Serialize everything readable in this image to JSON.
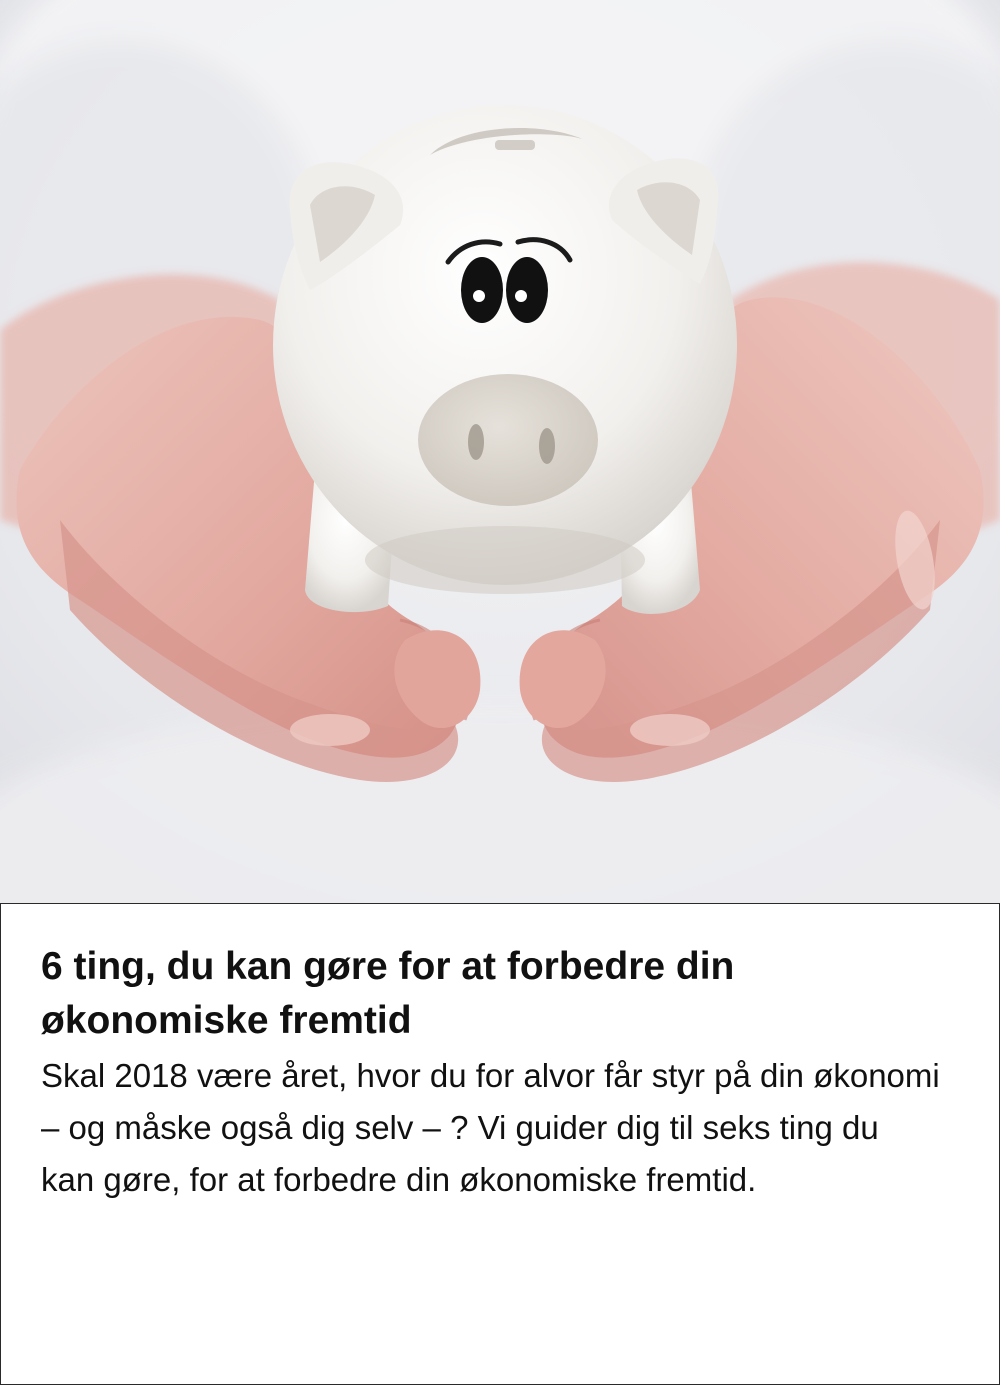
{
  "article": {
    "title": "6 ting, du kan gøre for at forbedre din økonomiske fremtid",
    "lede": "Skal 2018 være året, hvor du for alvor får styr på din økonomi – og måske også dig selv – ? Vi guider dig til seks ting du kan gøre, for at forbedre din økonomiske fremtid."
  },
  "image": {
    "subject": "piggy-bank-icon",
    "colors": {
      "background": "#e4e5ea",
      "shirt": "#f1f1f3",
      "skin": "#e3aea6",
      "piggy": "#f4f2ef",
      "snout": "#d9d4cc",
      "eyes": "#111111"
    }
  },
  "colors": {
    "text": "#111111",
    "panel_border": "#2a2a2a",
    "panel_background": "#ffffff"
  }
}
